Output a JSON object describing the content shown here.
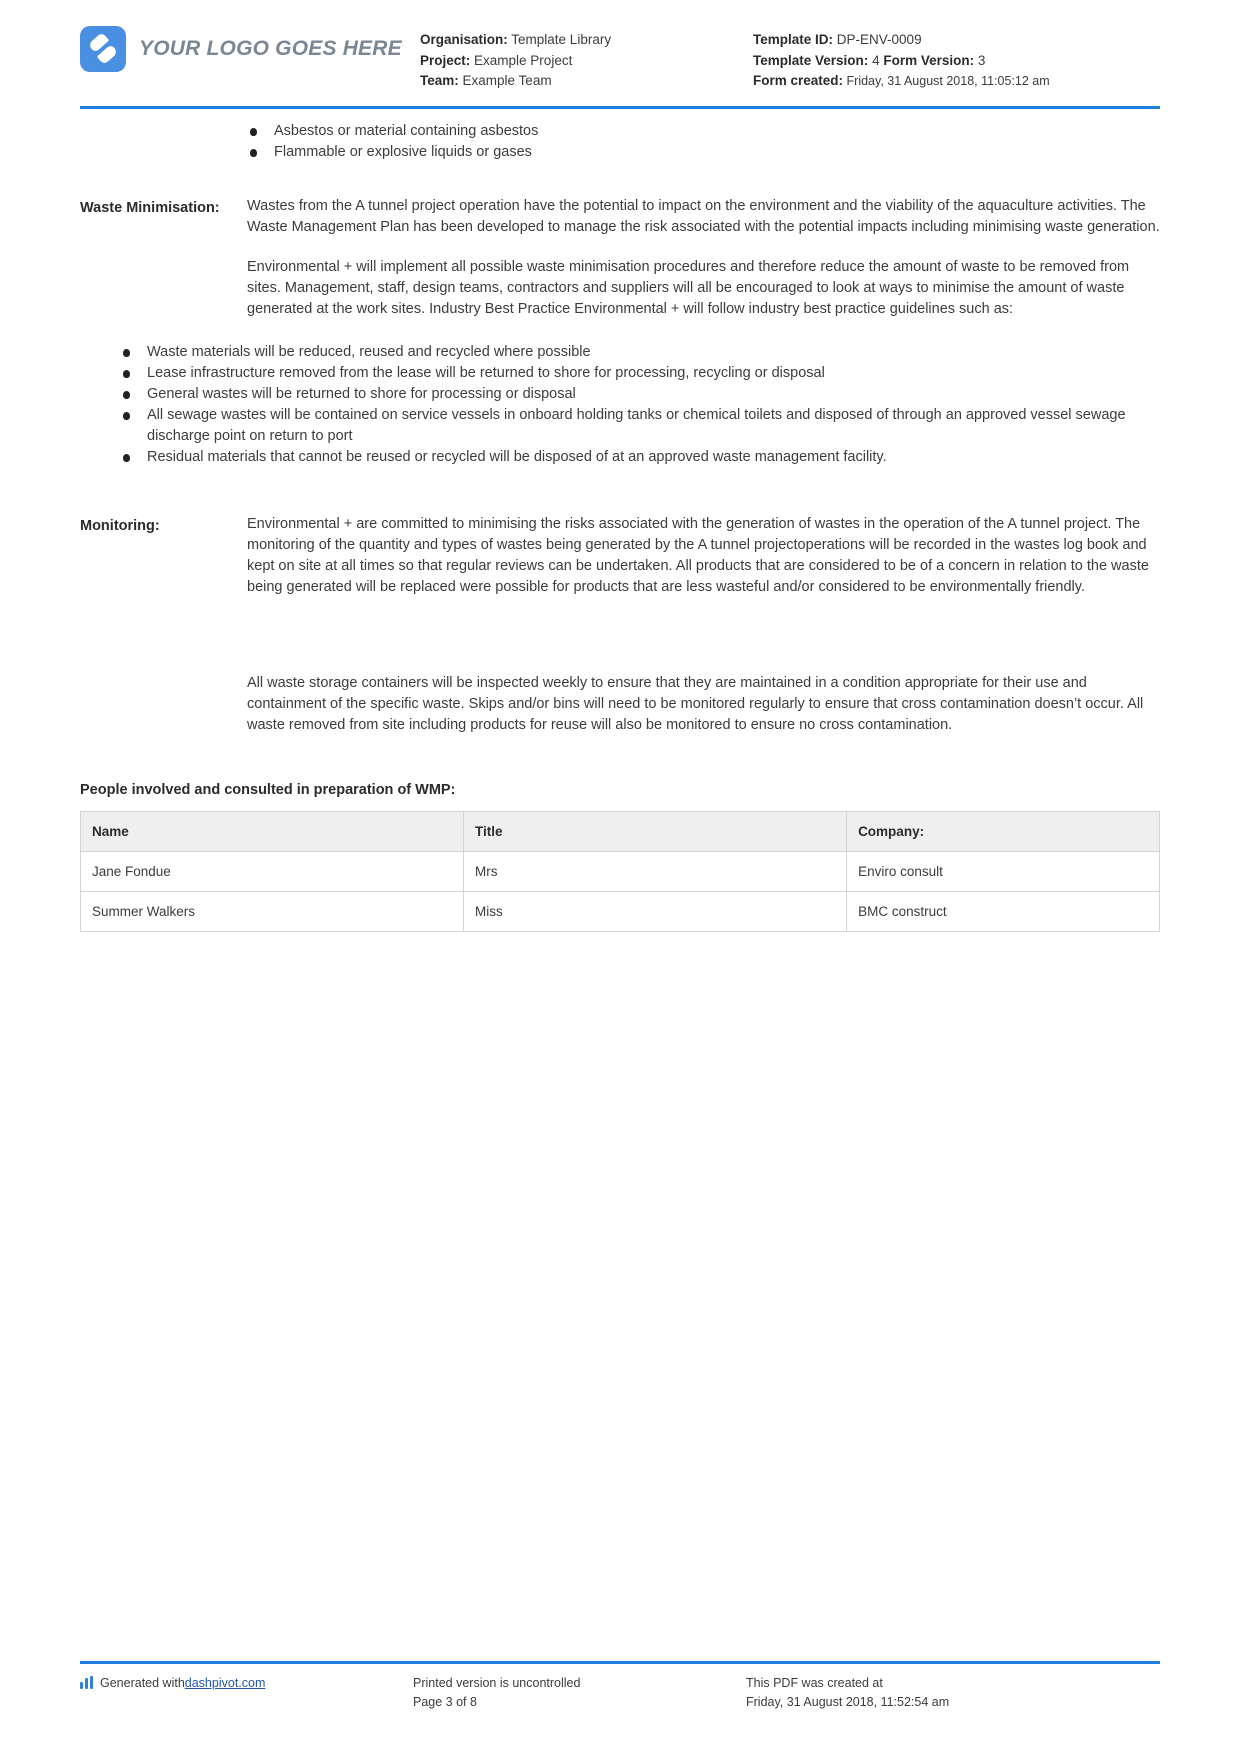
{
  "header": {
    "logo_text": "YOUR LOGO GOES HERE",
    "organisation_label": "Organisation:",
    "organisation_value": "Template Library",
    "project_label": "Project:",
    "project_value": "Example Project",
    "team_label": "Team:",
    "team_value": "Example Team",
    "template_id_label": "Template ID:",
    "template_id_value": "DP-ENV-0009",
    "template_version_label": "Template Version:",
    "template_version_value": "4",
    "form_version_label": "Form Version:",
    "form_version_value": "3",
    "form_created_label": "Form created:",
    "form_created_value": "Friday, 31 August 2018, 11:05:12 am"
  },
  "top_bullets": [
    "Asbestos or material containing asbestos",
    "Flammable or explosive liquids or gases"
  ],
  "waste_minimisation": {
    "label": "Waste Minimisation:",
    "paragraphs": [
      "Wastes from the A tunnel project operation have the potential to impact on the environment and the viability of the aquaculture activities. The Waste Management Plan has been developed to manage the risk associated with the potential impacts including minimising waste generation.",
      "Environmental + will implement all possible waste minimisation procedures and therefore reduce the amount of waste to be removed from sites. Management, staff, design teams, contractors and suppliers will all be encouraged to look at ways to minimise the amount of waste generated at the work sites. Industry Best Practice Environmental + will follow industry best practice guidelines such as:"
    ],
    "bullets": [
      "Waste materials will be reduced, reused and recycled where possible",
      "Lease infrastructure removed from the lease will be returned to shore for processing, recycling or disposal",
      "General wastes will be returned to shore for processing or disposal",
      "All sewage wastes will be contained on service vessels in onboard holding tanks or chemical toilets and disposed of through an approved vessel sewage discharge point on return to port",
      "Residual materials that cannot be reused or recycled will be disposed of at an approved waste management facility."
    ]
  },
  "monitoring": {
    "label": "Monitoring:",
    "paragraphs": [
      "Environmental + are committed to minimising the risks associated with the generation of wastes in the operation of the A tunnel project. The monitoring of the quantity and types of wastes being generated by the A tunnel projectoperations will be recorded in the wastes log book and kept on site at all times so that regular reviews can be undertaken. All products that are considered to be of a concern in relation to the waste being generated will be replaced were possible for products that are less wasteful and/or considered to be environmentally friendly.",
      "All waste storage containers will be inspected weekly to ensure that they are maintained in a condition appropriate for their use and containment of the specific waste. Skips and/or bins will need to be monitored regularly to ensure that cross contamination doesn’t occur. All waste removed from site including products for reuse will also be monitored to ensure no cross contamination."
    ]
  },
  "people_table": {
    "title": "People involved and consulted in preparation of WMP:",
    "columns": [
      "Name",
      "Title",
      "Company:"
    ],
    "rows": [
      {
        "name": "Jane Fondue",
        "title": "Mrs",
        "company": "Enviro consult"
      },
      {
        "name": "Summer Walkers",
        "title": "Miss",
        "company": "BMC construct"
      }
    ]
  },
  "footer": {
    "generated_prefix": "Generated with ",
    "generated_link": "dashpivot.com",
    "printed_notice": "Printed version is uncontrolled",
    "page_number": "Page 3 of 8",
    "pdf_created_label": "This PDF was created at",
    "pdf_created_value": "Friday, 31 August 2018, 11:52:54 am"
  }
}
